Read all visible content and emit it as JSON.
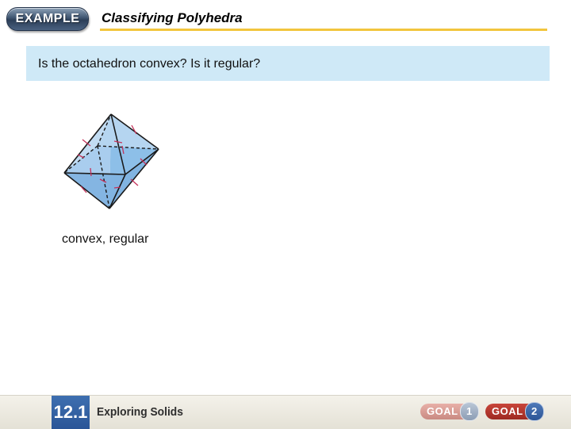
{
  "header": {
    "badge_label": "EXAMPLE",
    "title": "Classifying Polyhedra"
  },
  "question": {
    "text": "Is the octahedron convex? Is it regular?"
  },
  "answer": {
    "text": "convex, regular"
  },
  "footer": {
    "section_number": "12.1",
    "section_title": "Exploring Solids",
    "goals": [
      {
        "label": "GOAL",
        "number": "1"
      },
      {
        "label": "GOAL",
        "number": "2"
      }
    ]
  }
}
